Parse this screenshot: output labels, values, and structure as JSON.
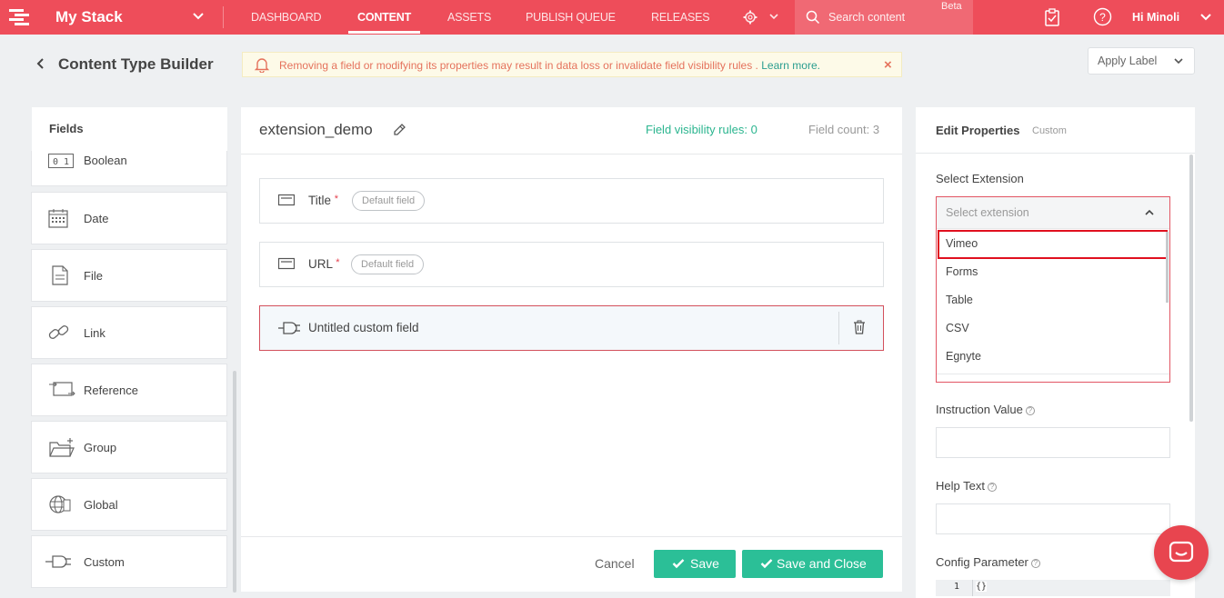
{
  "topnav": {
    "stack_name": "My Stack",
    "items": [
      {
        "label": "DASHBOARD",
        "active": false
      },
      {
        "label": "CONTENT",
        "active": true
      },
      {
        "label": "ASSETS",
        "active": false
      },
      {
        "label": "PUBLISH QUEUE",
        "active": false
      },
      {
        "label": "RELEASES",
        "active": false
      }
    ],
    "search_placeholder": "Search content",
    "beta_label": "Beta",
    "user_label": "Hi Minoli",
    "accent_color": "#ee4d5a"
  },
  "header": {
    "title": "Content Type Builder",
    "warning_text": "Removing a field or modifying its properties may result in data loss or invalidate field visibility rules .",
    "warning_link": "Learn more.",
    "warning_close": "×",
    "apply_label": "Apply Label"
  },
  "fields_panel": {
    "title": "Fields",
    "items": [
      {
        "label": "Boolean",
        "icon": "boolean-icon"
      },
      {
        "label": "Date",
        "icon": "calendar-icon"
      },
      {
        "label": "File",
        "icon": "file-icon"
      },
      {
        "label": "Link",
        "icon": "link-icon"
      },
      {
        "label": "Reference",
        "icon": "reference-icon"
      },
      {
        "label": "Group",
        "icon": "folder-plus-icon"
      },
      {
        "label": "Global",
        "icon": "globe-icon"
      },
      {
        "label": "Custom",
        "icon": "plug-icon"
      }
    ],
    "boolean_glyph": "0 1"
  },
  "main": {
    "content_type_name": "extension_demo",
    "visibility_rules": "Field visibility rules: 0",
    "field_count": "Field count: 3",
    "rows": [
      {
        "label": "Title",
        "required": "*",
        "badge": "Default field"
      },
      {
        "label": "URL",
        "required": "*",
        "badge": "Default field"
      },
      {
        "label": "Untitled custom field"
      }
    ],
    "cancel_label": "Cancel",
    "save_label": "Save",
    "save_close_label": "Save and Close",
    "save_color": "#2bbf97"
  },
  "properties": {
    "title": "Edit Properties",
    "subtitle": "Custom",
    "select_extension_label": "Select Extension",
    "select_placeholder": "Select extension",
    "options": [
      "Vimeo",
      "Forms",
      "Table",
      "CSV",
      "Egnyte"
    ],
    "highlighted_option": "Vimeo",
    "instruction_label": "Instruction Value",
    "help_label": "Help Text",
    "config_label": "Config Parameter",
    "config_line_number": "1",
    "config_code": "{}",
    "help_glyph": "?"
  }
}
